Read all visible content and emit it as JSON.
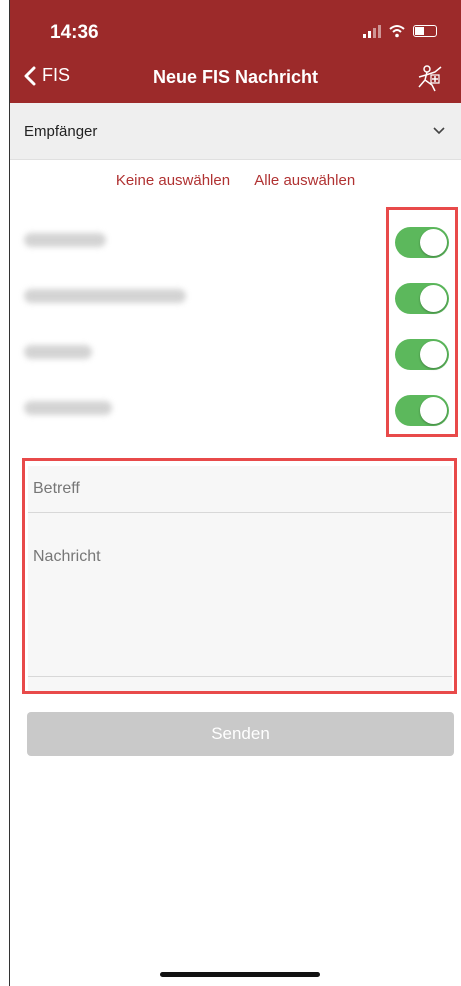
{
  "status": {
    "time": "14:36"
  },
  "nav": {
    "back_label": "FIS",
    "title": "Neue FIS Nachricht"
  },
  "recipients": {
    "dropdown_label": "Empfänger"
  },
  "select_links": {
    "none": "Keine auswählen",
    "all": "Alle auswählen"
  },
  "contacts": [
    {
      "name": "Aebi Raphael",
      "enabled": true
    },
    {
      "name": "Gasser Emanuel Julian",
      "enabled": true
    },
    {
      "name": "Klug Louis",
      "enabled": true
    },
    {
      "name": "Marrocan Nico",
      "enabled": true
    }
  ],
  "form": {
    "subject_placeholder": "Betreff",
    "message_placeholder": "Nachricht"
  },
  "send_label": "Senden",
  "colors": {
    "header": "#9c2a2a",
    "accent": "#b03232",
    "toggle_on": "#5cb85c",
    "highlight": "#e84a4a"
  }
}
